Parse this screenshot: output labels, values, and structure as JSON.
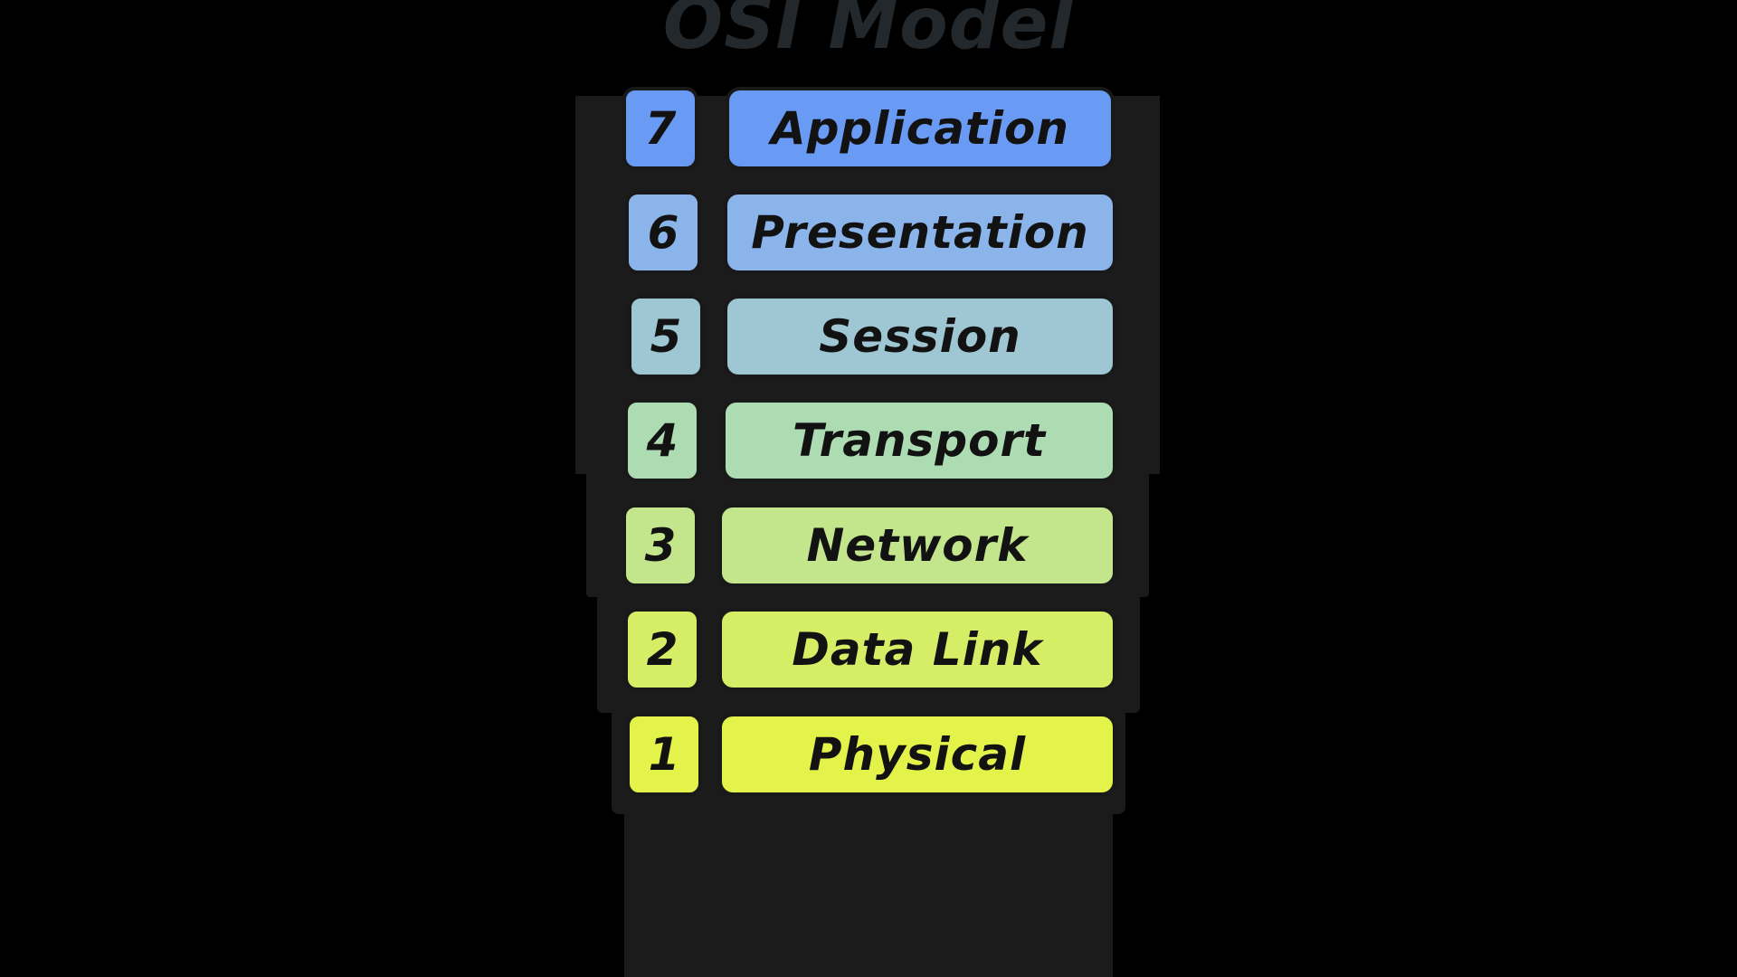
{
  "diagram": {
    "title": "OSI Model",
    "title_color": "#23282d",
    "background_color": "#000000",
    "backdrop_color": "#1b1b1b",
    "stroke_color": "#191919",
    "text_color": "#121212",
    "layers": [
      {
        "number": "7",
        "name": "Application",
        "color": "#6a9bf4"
      },
      {
        "number": "6",
        "name": "Presentation",
        "color": "#8ab4ea"
      },
      {
        "number": "5",
        "name": "Session",
        "color": "#9ec6d3"
      },
      {
        "number": "4",
        "name": "Transport",
        "color": "#aedcb2"
      },
      {
        "number": "3",
        "name": "Network",
        "color": "#c3e68c"
      },
      {
        "number": "2",
        "name": "Data Link",
        "color": "#d6ee66"
      },
      {
        "number": "1",
        "name": "Physical",
        "color": "#e4f34a"
      }
    ]
  }
}
